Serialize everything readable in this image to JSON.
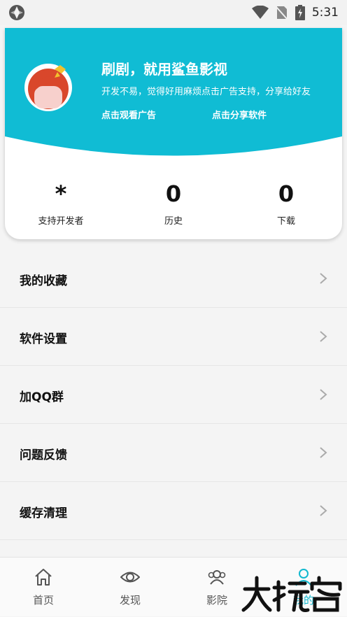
{
  "status_bar": {
    "time": "5:31"
  },
  "profile": {
    "headline": "刷剧，就用鲨鱼影视",
    "subline": "开发不易，觉得好用麻烦点击广告支持，分享给好友",
    "watch_ad": "点击观看广告",
    "share_app": "点击分享软件"
  },
  "stats": [
    {
      "value": "*",
      "label": "支持开发者"
    },
    {
      "value": "0",
      "label": "历史"
    },
    {
      "value": "0",
      "label": "下载"
    }
  ],
  "menu": [
    {
      "label": "我的收藏"
    },
    {
      "label": "软件设置"
    },
    {
      "label": "加QQ群"
    },
    {
      "label": "问题反馈"
    },
    {
      "label": "缓存清理"
    }
  ],
  "nav": [
    {
      "label": "首页",
      "icon": "home-icon"
    },
    {
      "label": "发现",
      "icon": "eye-icon"
    },
    {
      "label": "影院",
      "icon": "group-icon"
    },
    {
      "label": "我的",
      "icon": "user-icon"
    }
  ],
  "colors": {
    "accent": "#10bcd4",
    "active": "#11b8cf"
  }
}
